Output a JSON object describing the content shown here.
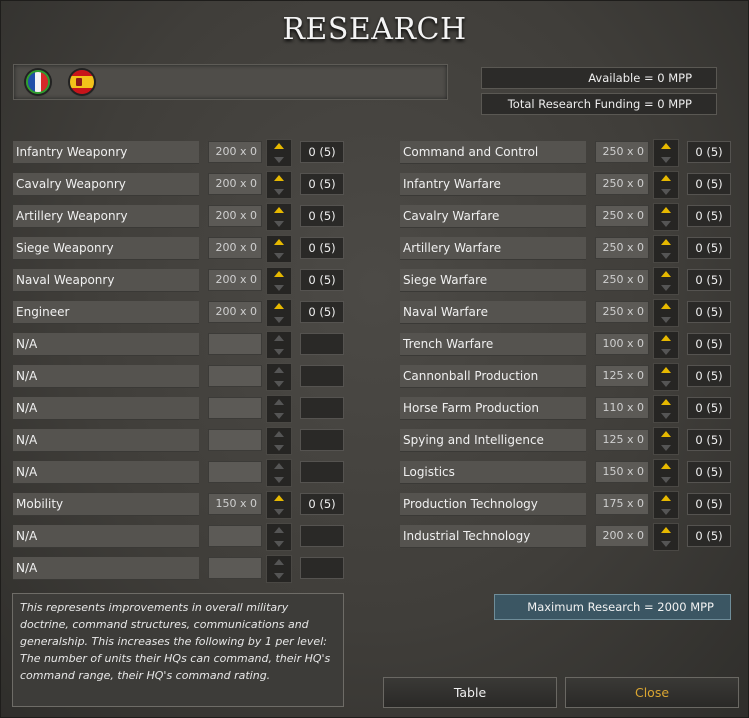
{
  "title": "RESEARCH",
  "flags": [
    {
      "name": "france",
      "colors": [
        "#1f4fa8",
        "#f4f4f4",
        "#d62a2a"
      ]
    },
    {
      "name": "spain",
      "colors": [
        "#c8141a",
        "#f3c21a",
        "#c8141a"
      ]
    }
  ],
  "funding": {
    "available": "Available = 0 MPP",
    "total": "Total Research Funding = 0 MPP"
  },
  "left_rows": [
    {
      "label": "Infantry Weaponry",
      "cost": "200 x 0",
      "level": "0 (5)",
      "active": true
    },
    {
      "label": "Cavalry Weaponry",
      "cost": "200 x 0",
      "level": "0 (5)",
      "active": true
    },
    {
      "label": "Artillery Weaponry",
      "cost": "200 x 0",
      "level": "0 (5)",
      "active": true
    },
    {
      "label": "Siege Weaponry",
      "cost": "200 x 0",
      "level": "0 (5)",
      "active": true
    },
    {
      "label": "Naval Weaponry",
      "cost": "200 x 0",
      "level": "0 (5)",
      "active": true
    },
    {
      "label": "Engineer",
      "cost": "200 x 0",
      "level": "0 (5)",
      "active": true
    },
    {
      "label": "N/A",
      "cost": "",
      "level": "",
      "active": false
    },
    {
      "label": "N/A",
      "cost": "",
      "level": "",
      "active": false
    },
    {
      "label": "N/A",
      "cost": "",
      "level": "",
      "active": false
    },
    {
      "label": "N/A",
      "cost": "",
      "level": "",
      "active": false
    },
    {
      "label": "N/A",
      "cost": "",
      "level": "",
      "active": false
    },
    {
      "label": "Mobility",
      "cost": "150 x 0",
      "level": "0 (5)",
      "active": true
    },
    {
      "label": "N/A",
      "cost": "",
      "level": "",
      "active": false
    },
    {
      "label": "N/A",
      "cost": "",
      "level": "",
      "active": false
    }
  ],
  "right_rows": [
    {
      "label": "Command and Control",
      "cost": "250 x 0",
      "level": "0 (5)",
      "active": true
    },
    {
      "label": "Infantry Warfare",
      "cost": "250 x 0",
      "level": "0 (5)",
      "active": true
    },
    {
      "label": "Cavalry Warfare",
      "cost": "250 x 0",
      "level": "0 (5)",
      "active": true
    },
    {
      "label": "Artillery Warfare",
      "cost": "250 x 0",
      "level": "0 (5)",
      "active": true
    },
    {
      "label": "Siege Warfare",
      "cost": "250 x 0",
      "level": "0 (5)",
      "active": true
    },
    {
      "label": "Naval Warfare",
      "cost": "250 x 0",
      "level": "0 (5)",
      "active": true
    },
    {
      "label": "Trench Warfare",
      "cost": "100 x 0",
      "level": "0 (5)",
      "active": true
    },
    {
      "label": "Cannonball Production",
      "cost": "125 x 0",
      "level": "0 (5)",
      "active": true
    },
    {
      "label": "Horse Farm Production",
      "cost": "110 x 0",
      "level": "0 (5)",
      "active": true
    },
    {
      "label": "Spying and Intelligence",
      "cost": "125 x 0",
      "level": "0 (5)",
      "active": true
    },
    {
      "label": "Logistics",
      "cost": "150 x 0",
      "level": "0 (5)",
      "active": true
    },
    {
      "label": "Production Technology",
      "cost": "175 x 0",
      "level": "0 (5)",
      "active": true
    },
    {
      "label": "Industrial Technology",
      "cost": "200 x 0",
      "level": "0 (5)",
      "active": true
    }
  ],
  "description": "This represents improvements in overall military doctrine, command structures, communications and generalship. This increases the following by 1 per level: The number of units their HQs can command, their HQ's command range, their HQ's command rating.",
  "max_research": "Maximum Research =  2000 MPP",
  "buttons": {
    "table": "Table",
    "close": "Close"
  },
  "colors": {
    "accent": "#e6b800",
    "close_text": "#d9a531",
    "max_research_bg": "#3b5663"
  }
}
